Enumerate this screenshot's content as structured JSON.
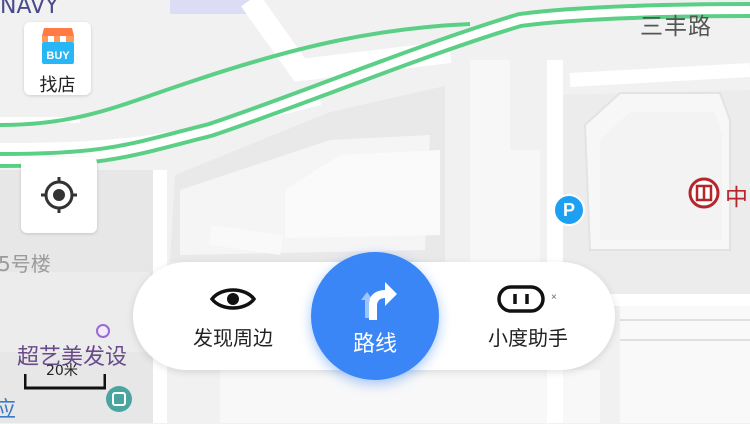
{
  "map_labels": {
    "top_left_partial": "NAVY",
    "road_name": "三丰路",
    "building_label": "5号楼",
    "poi_partial": "超艺美发设",
    "right_edge_partial": "中",
    "bottom_left_partial": "应"
  },
  "controls": {
    "store_finder": {
      "badge": "BUY",
      "label": "找店"
    }
  },
  "action_bar": {
    "discover": "发现周边",
    "route": "路线",
    "assistant": "小度助手"
  },
  "scale_bar": {
    "label": "20米"
  },
  "colors": {
    "route_blue": "#3a86f6",
    "road_green": "#5ccf86",
    "parking_blue": "#1ea0f2",
    "bank_red": "#b3262a"
  },
  "icons": {
    "store": "store-icon",
    "locate": "locate-icon",
    "discover": "eye-icon",
    "route": "route-arrow-icon",
    "assistant": "assistant-icon",
    "parking": "parking-icon",
    "bank": "bank-icon",
    "poi_dot": "poi-dot-icon",
    "metro": "metro-icon"
  }
}
